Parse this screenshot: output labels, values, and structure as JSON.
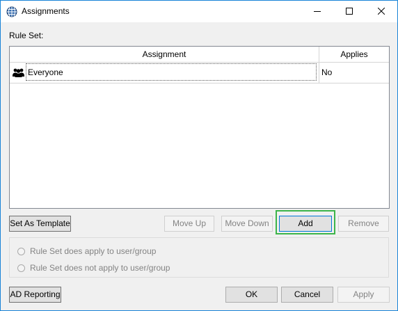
{
  "window": {
    "title": "Assignments",
    "icon": "globe-grid-icon",
    "controls": [
      "minimize-icon",
      "maximize-icon",
      "close-icon"
    ]
  },
  "rule_set_label": "Rule Set:",
  "grid": {
    "columns": [
      "Assignment",
      "Applies"
    ],
    "rows": [
      {
        "icon": "users-group-icon",
        "assignment": "Everyone",
        "applies": "No"
      }
    ]
  },
  "buttons": {
    "set_as_template": "Set As Template",
    "move_up": "Move Up",
    "move_down": "Move Down",
    "add": "Add",
    "remove": "Remove",
    "ad_reporting": "AD Reporting",
    "ok": "OK",
    "cancel": "Cancel",
    "apply": "Apply"
  },
  "radios": [
    {
      "label": "Rule Set does apply to user/group",
      "checked": false,
      "enabled": false
    },
    {
      "label": "Rule Set does not apply to user/group",
      "checked": false,
      "enabled": false
    }
  ],
  "highlight_color": "#3cb54a"
}
